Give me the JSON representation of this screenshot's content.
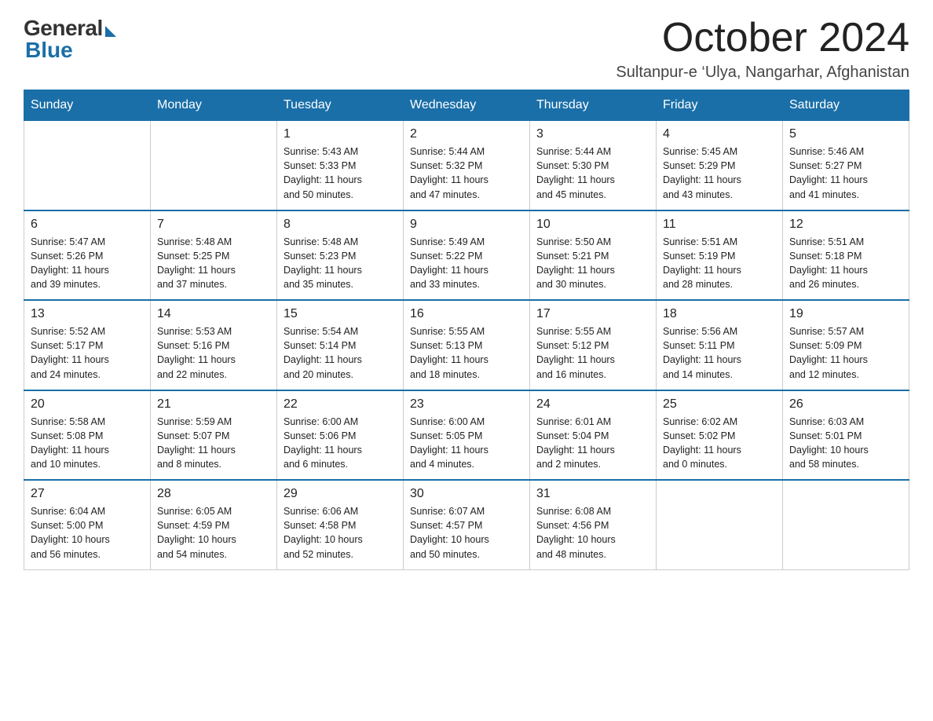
{
  "header": {
    "logo_general": "General",
    "logo_blue": "Blue",
    "month_title": "October 2024",
    "location": "Sultanpur-e ‘Ulya, Nangarhar, Afghanistan"
  },
  "weekdays": [
    "Sunday",
    "Monday",
    "Tuesday",
    "Wednesday",
    "Thursday",
    "Friday",
    "Saturday"
  ],
  "weeks": [
    [
      {
        "day": "",
        "info": ""
      },
      {
        "day": "",
        "info": ""
      },
      {
        "day": "1",
        "info": "Sunrise: 5:43 AM\nSunset: 5:33 PM\nDaylight: 11 hours\nand 50 minutes."
      },
      {
        "day": "2",
        "info": "Sunrise: 5:44 AM\nSunset: 5:32 PM\nDaylight: 11 hours\nand 47 minutes."
      },
      {
        "day": "3",
        "info": "Sunrise: 5:44 AM\nSunset: 5:30 PM\nDaylight: 11 hours\nand 45 minutes."
      },
      {
        "day": "4",
        "info": "Sunrise: 5:45 AM\nSunset: 5:29 PM\nDaylight: 11 hours\nand 43 minutes."
      },
      {
        "day": "5",
        "info": "Sunrise: 5:46 AM\nSunset: 5:27 PM\nDaylight: 11 hours\nand 41 minutes."
      }
    ],
    [
      {
        "day": "6",
        "info": "Sunrise: 5:47 AM\nSunset: 5:26 PM\nDaylight: 11 hours\nand 39 minutes."
      },
      {
        "day": "7",
        "info": "Sunrise: 5:48 AM\nSunset: 5:25 PM\nDaylight: 11 hours\nand 37 minutes."
      },
      {
        "day": "8",
        "info": "Sunrise: 5:48 AM\nSunset: 5:23 PM\nDaylight: 11 hours\nand 35 minutes."
      },
      {
        "day": "9",
        "info": "Sunrise: 5:49 AM\nSunset: 5:22 PM\nDaylight: 11 hours\nand 33 minutes."
      },
      {
        "day": "10",
        "info": "Sunrise: 5:50 AM\nSunset: 5:21 PM\nDaylight: 11 hours\nand 30 minutes."
      },
      {
        "day": "11",
        "info": "Sunrise: 5:51 AM\nSunset: 5:19 PM\nDaylight: 11 hours\nand 28 minutes."
      },
      {
        "day": "12",
        "info": "Sunrise: 5:51 AM\nSunset: 5:18 PM\nDaylight: 11 hours\nand 26 minutes."
      }
    ],
    [
      {
        "day": "13",
        "info": "Sunrise: 5:52 AM\nSunset: 5:17 PM\nDaylight: 11 hours\nand 24 minutes."
      },
      {
        "day": "14",
        "info": "Sunrise: 5:53 AM\nSunset: 5:16 PM\nDaylight: 11 hours\nand 22 minutes."
      },
      {
        "day": "15",
        "info": "Sunrise: 5:54 AM\nSunset: 5:14 PM\nDaylight: 11 hours\nand 20 minutes."
      },
      {
        "day": "16",
        "info": "Sunrise: 5:55 AM\nSunset: 5:13 PM\nDaylight: 11 hours\nand 18 minutes."
      },
      {
        "day": "17",
        "info": "Sunrise: 5:55 AM\nSunset: 5:12 PM\nDaylight: 11 hours\nand 16 minutes."
      },
      {
        "day": "18",
        "info": "Sunrise: 5:56 AM\nSunset: 5:11 PM\nDaylight: 11 hours\nand 14 minutes."
      },
      {
        "day": "19",
        "info": "Sunrise: 5:57 AM\nSunset: 5:09 PM\nDaylight: 11 hours\nand 12 minutes."
      }
    ],
    [
      {
        "day": "20",
        "info": "Sunrise: 5:58 AM\nSunset: 5:08 PM\nDaylight: 11 hours\nand 10 minutes."
      },
      {
        "day": "21",
        "info": "Sunrise: 5:59 AM\nSunset: 5:07 PM\nDaylight: 11 hours\nand 8 minutes."
      },
      {
        "day": "22",
        "info": "Sunrise: 6:00 AM\nSunset: 5:06 PM\nDaylight: 11 hours\nand 6 minutes."
      },
      {
        "day": "23",
        "info": "Sunrise: 6:00 AM\nSunset: 5:05 PM\nDaylight: 11 hours\nand 4 minutes."
      },
      {
        "day": "24",
        "info": "Sunrise: 6:01 AM\nSunset: 5:04 PM\nDaylight: 11 hours\nand 2 minutes."
      },
      {
        "day": "25",
        "info": "Sunrise: 6:02 AM\nSunset: 5:02 PM\nDaylight: 11 hours\nand 0 minutes."
      },
      {
        "day": "26",
        "info": "Sunrise: 6:03 AM\nSunset: 5:01 PM\nDaylight: 10 hours\nand 58 minutes."
      }
    ],
    [
      {
        "day": "27",
        "info": "Sunrise: 6:04 AM\nSunset: 5:00 PM\nDaylight: 10 hours\nand 56 minutes."
      },
      {
        "day": "28",
        "info": "Sunrise: 6:05 AM\nSunset: 4:59 PM\nDaylight: 10 hours\nand 54 minutes."
      },
      {
        "day": "29",
        "info": "Sunrise: 6:06 AM\nSunset: 4:58 PM\nDaylight: 10 hours\nand 52 minutes."
      },
      {
        "day": "30",
        "info": "Sunrise: 6:07 AM\nSunset: 4:57 PM\nDaylight: 10 hours\nand 50 minutes."
      },
      {
        "day": "31",
        "info": "Sunrise: 6:08 AM\nSunset: 4:56 PM\nDaylight: 10 hours\nand 48 minutes."
      },
      {
        "day": "",
        "info": ""
      },
      {
        "day": "",
        "info": ""
      }
    ]
  ]
}
